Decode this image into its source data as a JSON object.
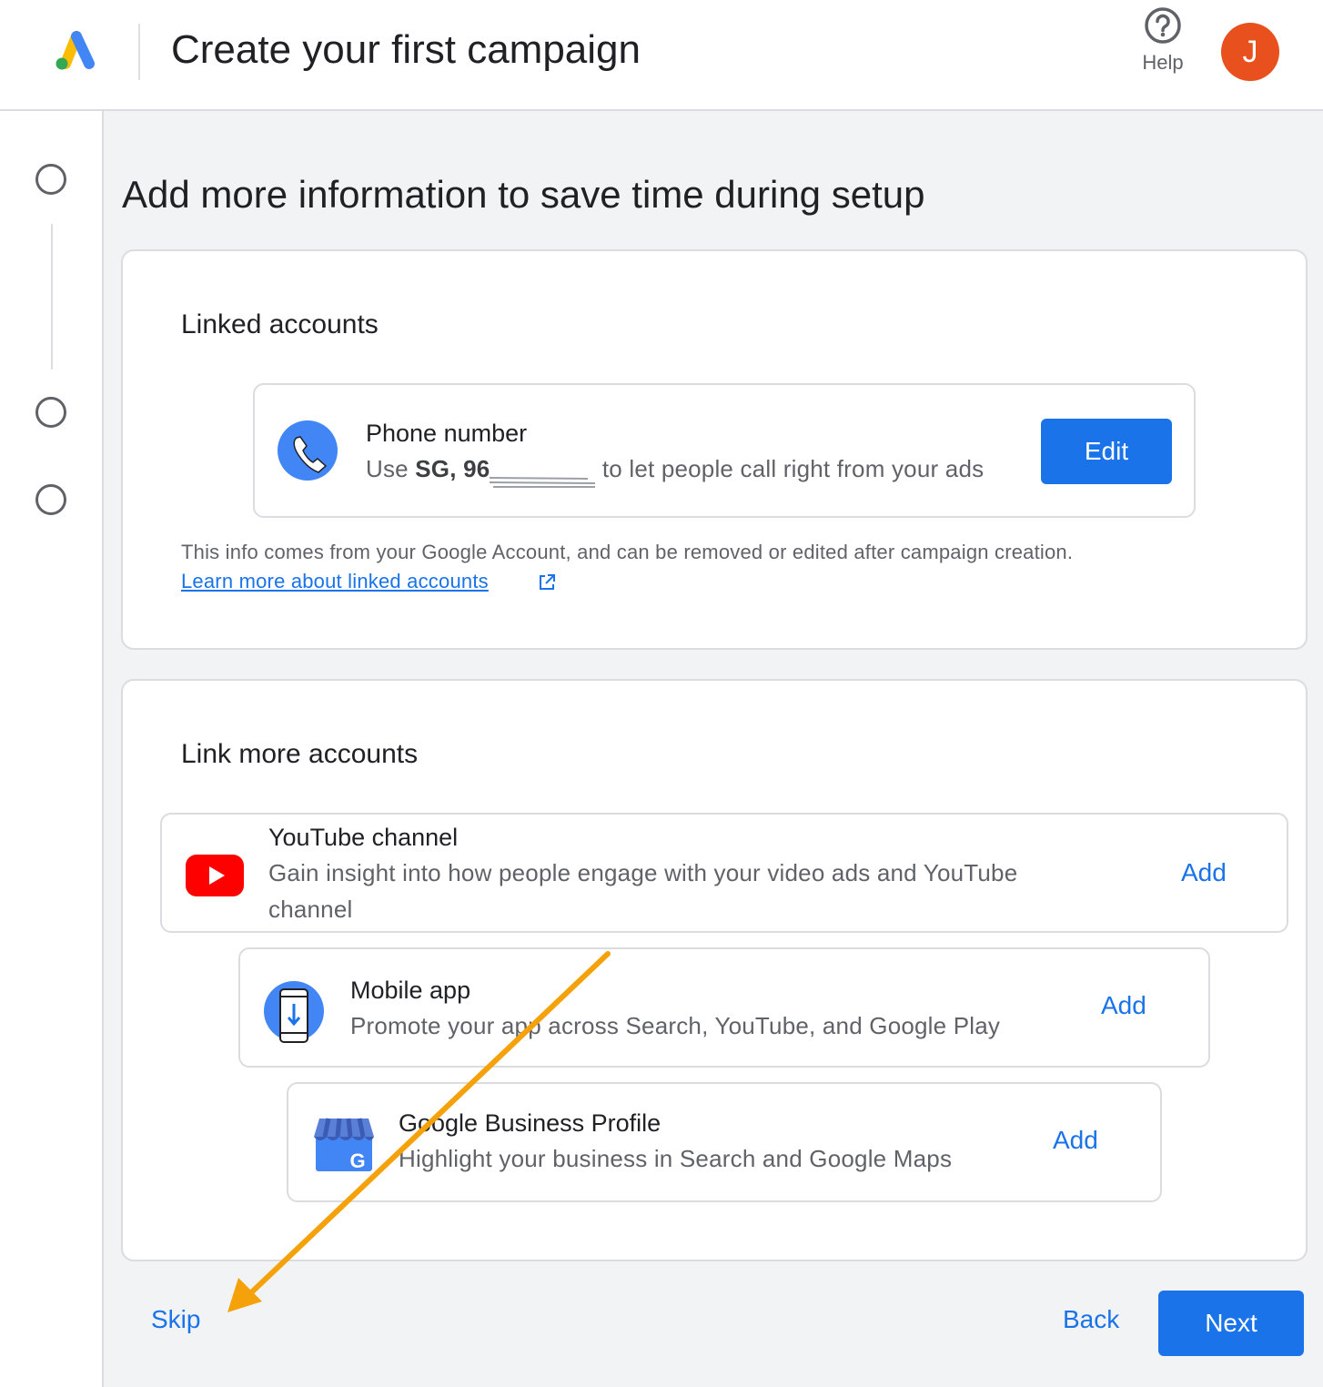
{
  "header": {
    "title": "Create your first campaign",
    "help_label": "Help",
    "avatar_initial": "J"
  },
  "main": {
    "heading": "Add more information to save time during setup"
  },
  "linked_accounts": {
    "title": "Linked accounts",
    "phone": {
      "title": "Phone number",
      "desc_prefix": "Use ",
      "desc_bold": "SG, 96",
      "desc_suffix": " to let people call right from your ads",
      "edit_label": "Edit"
    },
    "info_text": "This info comes from your Google Account, and can be removed or edited after campaign creation.",
    "learn_more": "Learn more about linked accounts"
  },
  "link_more": {
    "title": "Link more accounts",
    "items": [
      {
        "title": "YouTube channel",
        "desc": "Gain insight into how people engage with your video ads and YouTube channel",
        "action": "Add"
      },
      {
        "title": "Mobile app",
        "desc": "Promote your app across Search, YouTube, and Google Play",
        "action": "Add"
      },
      {
        "title": "Google Business Profile",
        "desc": "Highlight your business in Search and Google Maps",
        "action": "Add"
      }
    ]
  },
  "footer": {
    "skip": "Skip",
    "back": "Back",
    "next": "Next"
  },
  "colors": {
    "accent": "#1a73e8",
    "avatar": "#e8501e",
    "annotation_arrow": "#f5a10a"
  }
}
